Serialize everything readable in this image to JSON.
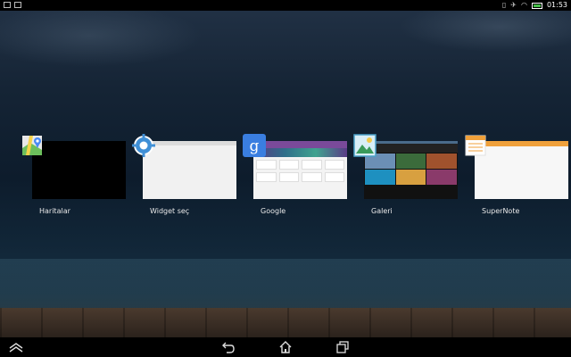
{
  "status_bar": {
    "time": "01:53",
    "icons": [
      "image-icon",
      "notification-icon",
      "vibrate-icon",
      "airplane-icon",
      "wifi-icon",
      "battery-icon"
    ],
    "battery_color": "#49c14b"
  },
  "recent_apps": [
    {
      "label": "Haritalar",
      "icon": "maps-icon"
    },
    {
      "label": "Widget seç",
      "icon": "settings-gear-icon"
    },
    {
      "label": "Google",
      "icon": "google-icon"
    },
    {
      "label": "Galeri",
      "icon": "gallery-icon"
    },
    {
      "label": "SuperNote",
      "icon": "supernote-icon"
    }
  ],
  "nav_bar": {
    "buttons": [
      "collapse-up-icon",
      "back-icon",
      "home-icon",
      "recent-apps-icon"
    ]
  }
}
